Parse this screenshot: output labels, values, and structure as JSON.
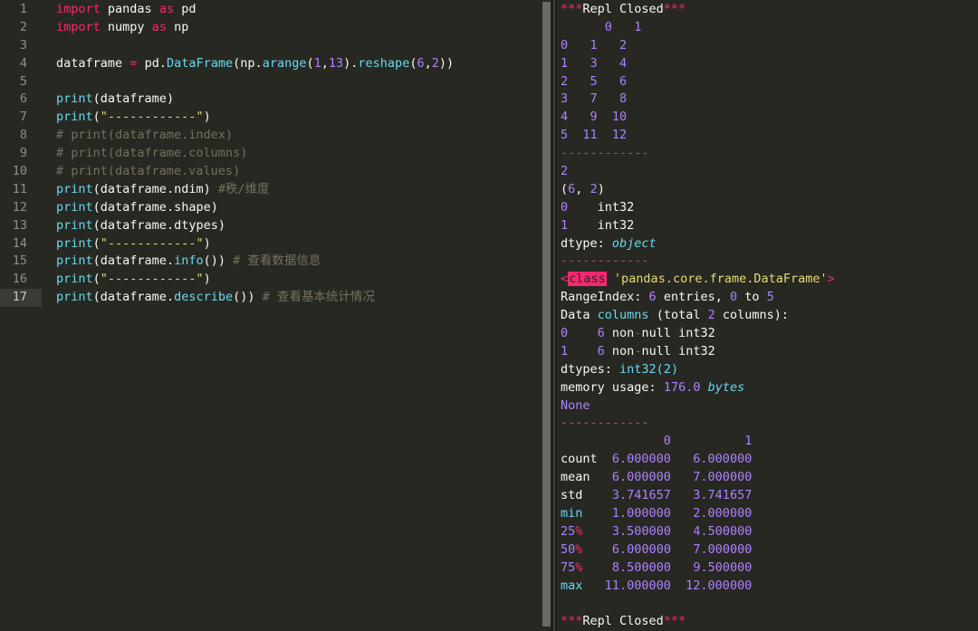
{
  "theme": {
    "background": "#272822",
    "foreground": "#f8f8f2",
    "keyword": "#f92672",
    "function": "#66d9ef",
    "number": "#ae81ff",
    "string": "#e6db74",
    "comment": "#75715e",
    "gutter_text": "#8f908a",
    "active_line_gutter": "#3a3b35",
    "scrollbar": "#6a6b63",
    "divider": "#1d1e19"
  },
  "editor": {
    "total_lines": 17,
    "active_line": 17,
    "line_numbers": [
      "1",
      "2",
      "3",
      "4",
      "5",
      "6",
      "7",
      "8",
      "9",
      "10",
      "11",
      "12",
      "13",
      "14",
      "15",
      "16",
      "17"
    ],
    "lines": [
      {
        "n": "1",
        "text": "import pandas as pd"
      },
      {
        "n": "2",
        "text": "import numpy as np"
      },
      {
        "n": "3",
        "text": ""
      },
      {
        "n": "4",
        "text": "dataframe = pd.DataFrame(np.arange(1,13).reshape(6,2))"
      },
      {
        "n": "5",
        "text": ""
      },
      {
        "n": "6",
        "text": "print(dataframe)"
      },
      {
        "n": "7",
        "text": "print(\"------------\")"
      },
      {
        "n": "8",
        "text": "# print(dataframe.index)"
      },
      {
        "n": "9",
        "text": "# print(dataframe.columns)"
      },
      {
        "n": "10",
        "text": "# print(dataframe.values)"
      },
      {
        "n": "11",
        "text": "print(dataframe.ndim) #秩/维度"
      },
      {
        "n": "12",
        "text": "print(dataframe.shape)"
      },
      {
        "n": "13",
        "text": "print(dataframe.dtypes)"
      },
      {
        "n": "14",
        "text": "print(\"------------\")"
      },
      {
        "n": "15",
        "text": "print(dataframe.info()) # 查看数据信息"
      },
      {
        "n": "16",
        "text": "print(\"------------\")"
      },
      {
        "n": "17",
        "text": "print(dataframe.describe()) # 查看基本统计情况"
      }
    ]
  },
  "repl": {
    "header": {
      "stars": "***",
      "label": "Repl Closed"
    },
    "footer": {
      "stars": "***",
      "label": "Repl Closed"
    },
    "separator": "------------",
    "dataframe_print": {
      "columns": [
        "0",
        "1"
      ],
      "index": [
        "0",
        "1",
        "2",
        "3",
        "4",
        "5"
      ],
      "rows": [
        [
          "0",
          "1",
          "2"
        ],
        [
          "1",
          "3",
          "4"
        ],
        [
          "2",
          "5",
          "6"
        ],
        [
          "3",
          "7",
          "8"
        ],
        [
          "4",
          "9",
          "10"
        ],
        [
          "5",
          "11",
          "12"
        ]
      ]
    },
    "ndim": "2",
    "shape": "(6, 2)",
    "dtypes": {
      "entries": [
        {
          "col": "0",
          "type": "int32"
        },
        {
          "col": "1",
          "type": "int32"
        }
      ],
      "dtype_line_label": "dtype:",
      "dtype_line_value": "object"
    },
    "info": {
      "class_open": "<",
      "class_kw": "class",
      "class_path": "'pandas.core.frame.DataFrame'",
      "class_close": ">",
      "rangeindex": {
        "label": "RangeIndex:",
        "entries": "6",
        "entries_word": "entries,",
        "from": "0",
        "to_word": "to",
        "to": "5"
      },
      "data_columns": {
        "a": "Data",
        "b": "columns",
        "c": "(total",
        "d": "2",
        "e": "columns):"
      },
      "columns": [
        {
          "idx": "0",
          "count": "6",
          "nonnull": "non-null",
          "type": "int32"
        },
        {
          "idx": "1",
          "count": "6",
          "nonnull": "non-null",
          "type": "int32"
        }
      ],
      "dtypes_line": {
        "label": "dtypes:",
        "value": "int32(2)"
      },
      "memory_line": {
        "label": "memory usage:",
        "value": "176.0",
        "unit": "bytes"
      },
      "none": "None"
    },
    "describe": {
      "columns": [
        "0",
        "1"
      ],
      "rows": [
        {
          "stat": "count",
          "values": [
            "6.000000",
            "6.000000"
          ]
        },
        {
          "stat": "mean",
          "values": [
            "6.000000",
            "7.000000"
          ]
        },
        {
          "stat": "std",
          "values": [
            "3.741657",
            "3.741657"
          ]
        },
        {
          "stat": "min",
          "values": [
            "1.000000",
            "2.000000"
          ]
        },
        {
          "stat": "25%",
          "values": [
            "3.500000",
            "4.500000"
          ]
        },
        {
          "stat": "50%",
          "values": [
            "6.000000",
            "7.000000"
          ]
        },
        {
          "stat": "75%",
          "values": [
            "8.500000",
            "9.500000"
          ]
        },
        {
          "stat": "max",
          "values": [
            "11.000000",
            "12.000000"
          ]
        }
      ]
    }
  }
}
